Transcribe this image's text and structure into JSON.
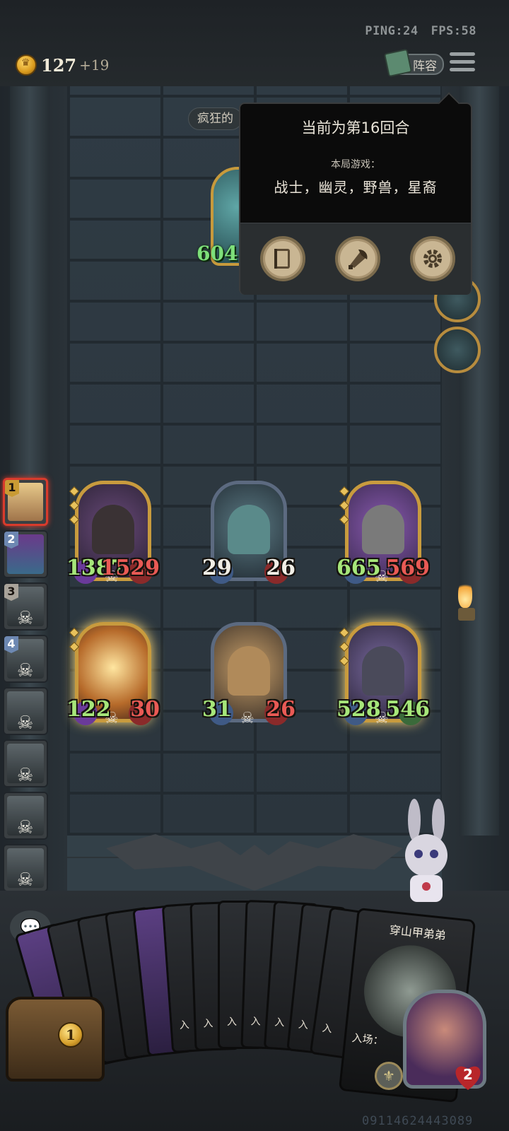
{
  "topbar": {
    "ping_label": "PING:24",
    "fps_label": "FPS:58",
    "gold": "127",
    "gold_income": "+19",
    "lineup_label": "阵容"
  },
  "opponent": {
    "name_label": "疯狂的",
    "hero_health": "604"
  },
  "popup": {
    "round_text": "当前为第16回合",
    "game_label": "本局游戏：",
    "tribes": "战士，幽灵，野兽，星裔",
    "icons": [
      "book-icon",
      "axe-helmet-icon",
      "gear-icon"
    ]
  },
  "players": [
    {
      "rank": "1"
    },
    {
      "rank": "2"
    },
    {
      "rank": "3"
    },
    {
      "rank": "4"
    },
    {
      "rank": ""
    },
    {
      "rank": ""
    },
    {
      "rank": ""
    },
    {
      "rank": ""
    }
  ],
  "minions": [
    {
      "attack": "1387",
      "health": "1529"
    },
    {
      "attack": "29",
      "health": "26"
    },
    {
      "attack": "665",
      "health": "569"
    },
    {
      "attack": "122",
      "health": "30"
    },
    {
      "attack": "31",
      "health": "26"
    },
    {
      "attack": "528",
      "health": "546"
    }
  ],
  "hand": {
    "card_labels": [
      "入",
      "入",
      "入",
      "入",
      "入",
      "入",
      "入"
    ],
    "focus_card": {
      "name": "穿山甲弟弟",
      "text": "入场："
    }
  },
  "bottom": {
    "tavern_tier": "1",
    "hero_health": "2",
    "watermark": "09114624443089"
  }
}
